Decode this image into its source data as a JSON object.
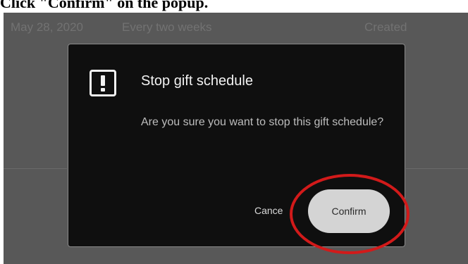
{
  "caption": "Click \"Confirm\" on the popup.",
  "background_row": {
    "date": "May 28, 2020",
    "frequency": "Every two weeks",
    "status": "Created"
  },
  "modal": {
    "icon": "exclamation-icon",
    "title": "Stop gift schedule",
    "message": "Are you sure you want to stop this gift schedule?",
    "cancel_label": "Cance",
    "confirm_label": "Confirm"
  },
  "colors": {
    "overlay": "#585858",
    "modal_background": "#0f0f0f",
    "confirm_button": "#d4d4d4",
    "highlight": "#d21a1a"
  }
}
